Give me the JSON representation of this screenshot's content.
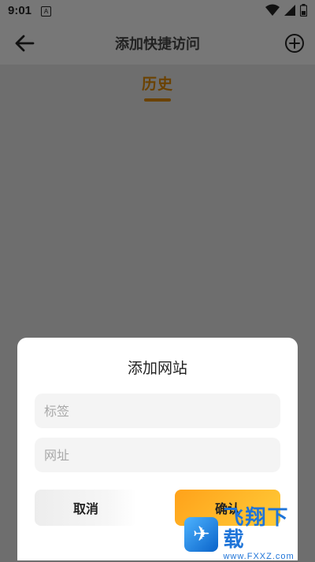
{
  "status_bar": {
    "time": "9:01",
    "app_icon": "A"
  },
  "header": {
    "title": "添加快捷访问"
  },
  "tabs": [
    {
      "label": "历史",
      "active": true
    }
  ],
  "dialog": {
    "title": "添加网站",
    "label_field": {
      "placeholder": "标签",
      "value": ""
    },
    "url_field": {
      "placeholder": "网址",
      "value": ""
    },
    "cancel_label": "取消",
    "confirm_label": "确认"
  },
  "watermark": {
    "brand": "飞翔下载",
    "url": "www.FXXZ.com"
  },
  "colors": {
    "accent": "#ffb020",
    "tab_active": "#6b4200",
    "overlay": "#6e6e6e"
  },
  "icons": [
    "back-arrow-icon",
    "add-circle-icon",
    "wifi-icon",
    "signal-icon",
    "battery-icon"
  ]
}
